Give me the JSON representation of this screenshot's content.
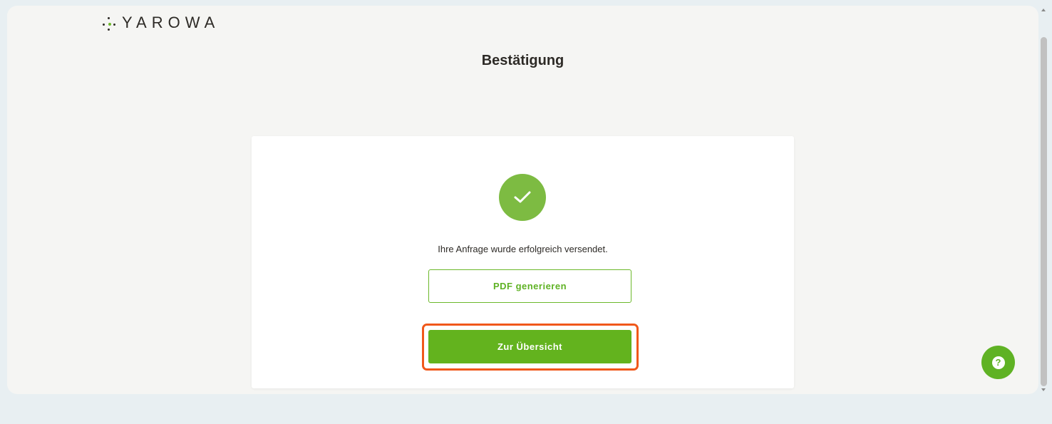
{
  "brand": {
    "name": "YAROWA",
    "accent_color": "#63b31e",
    "highlight_color": "#f0581a"
  },
  "page": {
    "title": "Bestätigung"
  },
  "confirmation": {
    "icon": "check-circle-icon",
    "message": "Ihre Anfrage wurde erfolgreich versendet.",
    "pdf_button_label": "PDF generieren",
    "overview_button_label": "Zur Übersicht"
  },
  "help": {
    "icon": "question-mark-icon",
    "glyph": "?"
  }
}
